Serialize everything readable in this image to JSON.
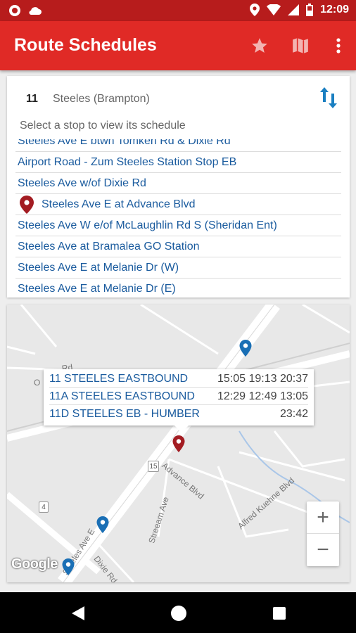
{
  "status_bar": {
    "time": "12:09"
  },
  "app_bar": {
    "title": "Route Schedules",
    "favorite_icon": "star-icon",
    "map_icon": "map-icon",
    "overflow_icon": "more-vert-icon",
    "background": "#e02a26",
    "status_background": "#b71c1c"
  },
  "route": {
    "number": "11",
    "name": "Steeles (Brampton)",
    "hint": "Select a stop to view its schedule",
    "stops": [
      "Steeles Ave E btwn Tomken Rd & Dixie Rd",
      "Airport Road - Zum Steeles Station Stop EB",
      "Steeles Ave w/of Dixie Rd",
      "Steeles Ave E at Advance Blvd",
      "Steeles Ave W e/of McLaughlin Rd S (Sheridan Ent)",
      "Steeles Ave at Bramalea GO Station",
      "Steeles Ave E at Melanie Dr (W)",
      "Steeles Ave E at Melanie Dr (E)"
    ],
    "selected_stop_index": 3,
    "link_color": "#1a5b9e",
    "pin_color": "#a31c22"
  },
  "map": {
    "popup": [
      {
        "route": "11 STEELES EASTBOUND",
        "times": "15:05 19:13 20:37"
      },
      {
        "route": "11A STEELES EASTBOUND",
        "times": "12:29 12:49 13:05"
      },
      {
        "route": "11D STEELES EB - HUMBER",
        "times": "23:42"
      }
    ],
    "labels": {
      "advance_blvd": "Advance Blvd",
      "streeam_ave": "Streeam Ave",
      "alfred_kuehne": "Alfred Kuehne Blvd",
      "dixie_rd": "Dixie Rd",
      "steeles_ave_e": "Steeles Ave E",
      "route_15": "15",
      "route_4": "4",
      "partial_rd": "Rd",
      "partial_o": "O"
    },
    "attribution": "Google",
    "zoom_in": "+",
    "zoom_out": "−"
  }
}
